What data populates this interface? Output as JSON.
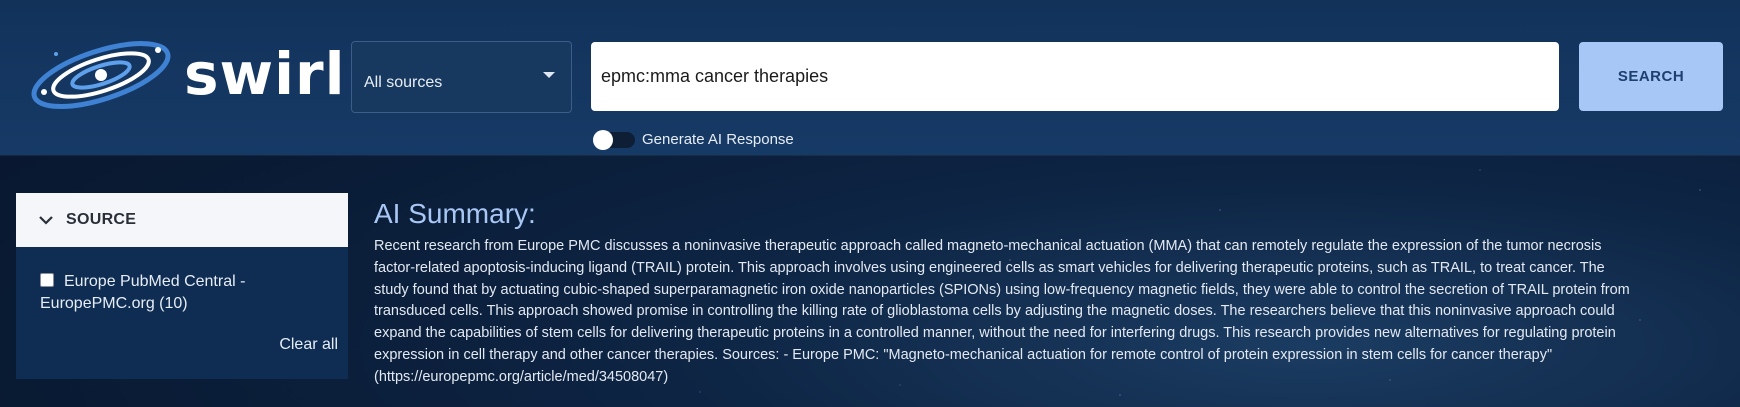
{
  "brand": {
    "name": "swirl"
  },
  "search": {
    "source_selected": "All sources",
    "query": "epmc:mma cancer therapies",
    "button_label": "SEARCH",
    "ai_toggle_label": "Generate AI Response",
    "ai_toggle_on": false
  },
  "facets": {
    "title": "SOURCE",
    "options": [
      {
        "label": "Europe PubMed Central - EuropePMC.org (10)",
        "checked": false
      }
    ],
    "clear_label": "Clear all"
  },
  "summary": {
    "heading": "AI Summary:",
    "text": "Recent research from Europe PMC discusses a noninvasive therapeutic approach called magneto-mechanical actuation (MMA) that can remotely regulate the expression of the tumor necrosis factor-related apoptosis-inducing ligand (TRAIL) protein. This approach involves using engineered cells as smart vehicles for delivering therapeutic proteins, such as TRAIL, to treat cancer. The study found that by actuating cubic-shaped superparamagnetic iron oxide nanoparticles (SPIONs) using low-frequency magnetic fields, they were able to control the secretion of TRAIL protein from transduced cells. This approach showed promise in controlling the killing rate of glioblastoma cells by adjusting the magnetic doses. The researchers believe that this noninvasive approach could expand the capabilities of stem cells for delivering therapeutic proteins in a controlled manner, without the need for interfering drugs. This research provides new alternatives for regulating protein expression in cell therapy and other cancer therapies. Sources: - Europe PMC: \"Magneto-mechanical actuation for remote control of protein expression in stem cells for cancer therapy\" (https://europepmc.org/article/med/34508047)"
  },
  "colors": {
    "header_bg": "#163a66",
    "page_bg": "#091a33",
    "search_button_bg": "#a7c8f7",
    "summary_heading": "#a9c7f5"
  }
}
